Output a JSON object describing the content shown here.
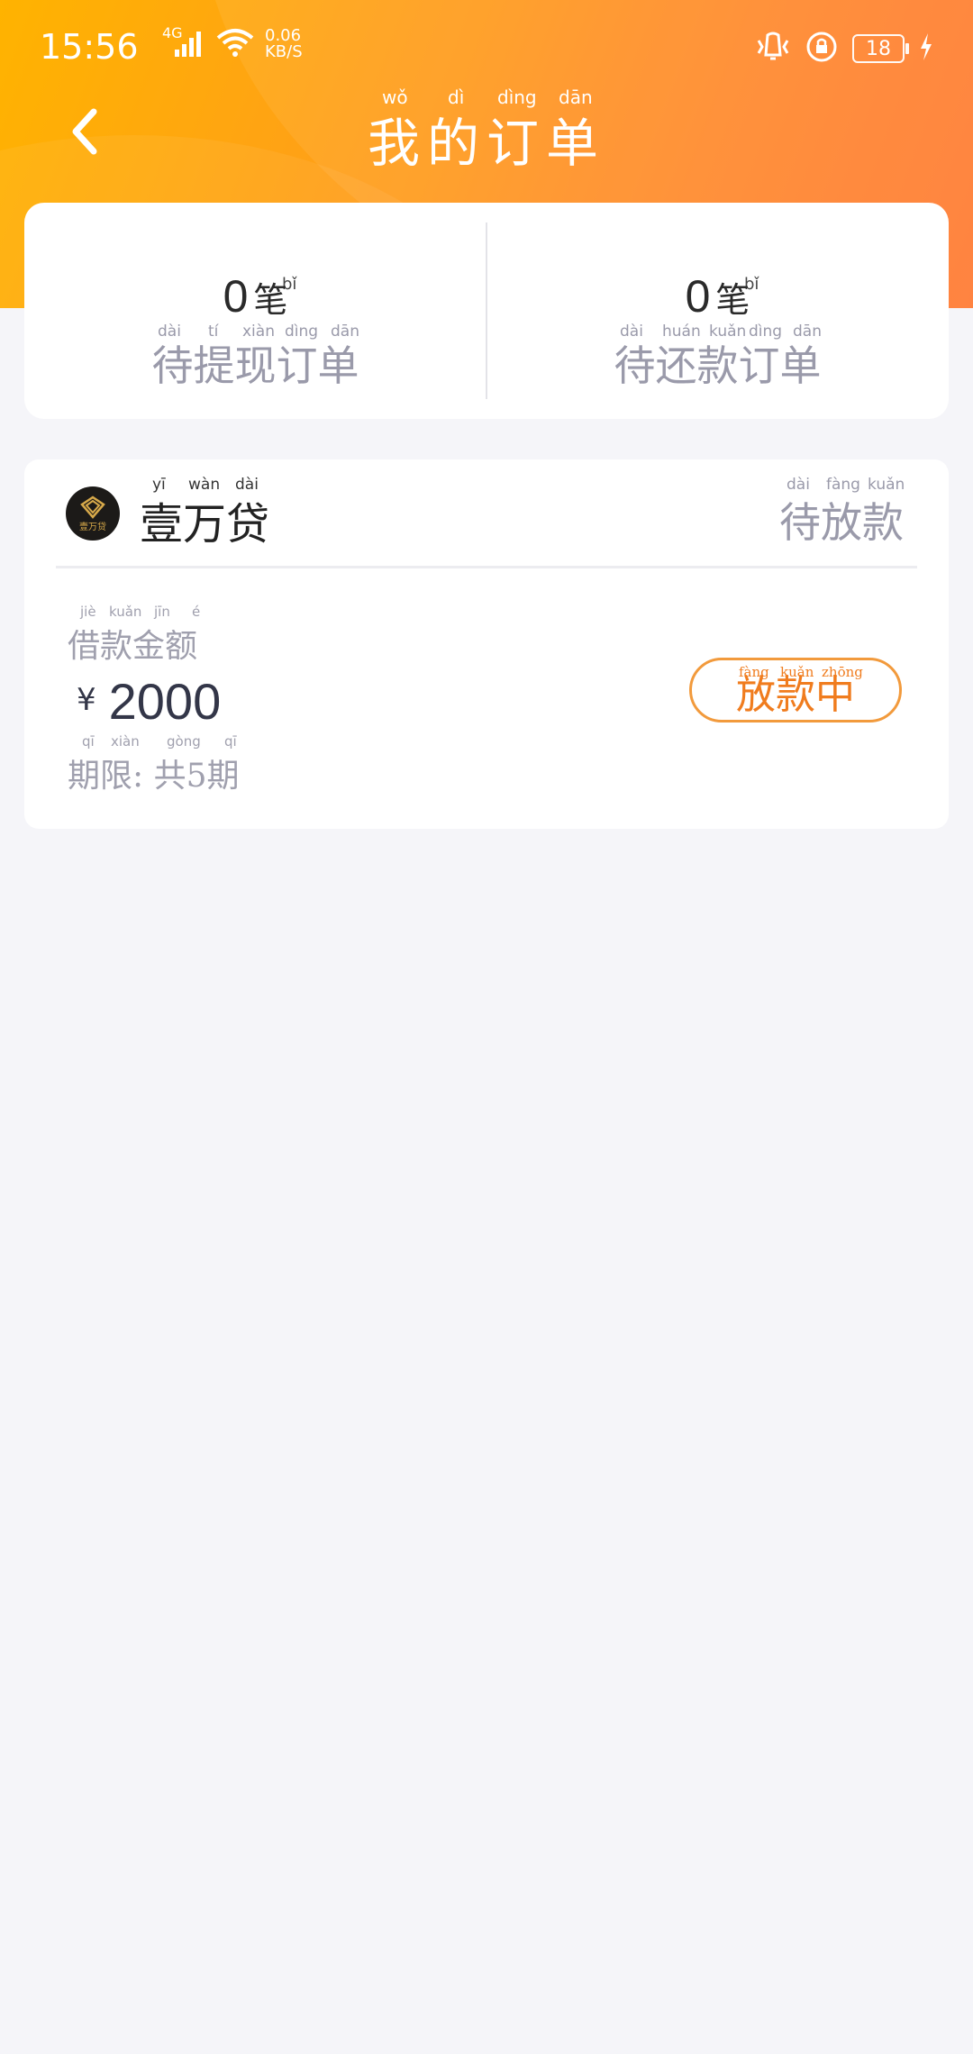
{
  "status_bar": {
    "time": "15:56",
    "network": "4G",
    "speed_value": "0.06",
    "speed_unit": "KB/S",
    "battery": "18"
  },
  "header": {
    "title": "我的订单",
    "title_pinyin": [
      "wǒ",
      "dì",
      "dìng",
      "dān"
    ]
  },
  "summary": [
    {
      "count": "0",
      "unit": "笔",
      "unit_pinyin": "bǐ",
      "label": "待提现订单",
      "label_pinyin": [
        "dài",
        "tí",
        "xiàn",
        "dìng",
        "dān"
      ]
    },
    {
      "count": "0",
      "unit": "笔",
      "unit_pinyin": "bǐ",
      "label": "待还款订单",
      "label_pinyin": [
        "dài",
        "huán",
        "kuǎn",
        "dìng",
        "dān"
      ]
    }
  ],
  "order": {
    "lender_name": "壹万贷",
    "lender_pinyin": [
      "yī",
      "wàn",
      "dài"
    ],
    "logo_text": "壹万贷",
    "status": "待放款",
    "status_pinyin": [
      "dài",
      "fàng",
      "kuǎn"
    ],
    "amount_label": "借款金额",
    "amount_label_pinyin": [
      "jiè",
      "kuǎn",
      "jīn",
      "é"
    ],
    "currency": "¥",
    "amount": "2000",
    "term": "期限: 共5期",
    "term_pinyin": [
      "qī",
      "xiàn",
      "gòng",
      "qī"
    ],
    "action_button": "放款中",
    "action_pinyin": [
      "fàng",
      "kuǎn",
      "zhōng"
    ]
  },
  "colors": {
    "header_start": "#ffb300",
    "header_end": "#ff7a33",
    "accent": "#f07c1e",
    "muted_text": "#9a9aaa",
    "background": "#f5f5f9"
  }
}
